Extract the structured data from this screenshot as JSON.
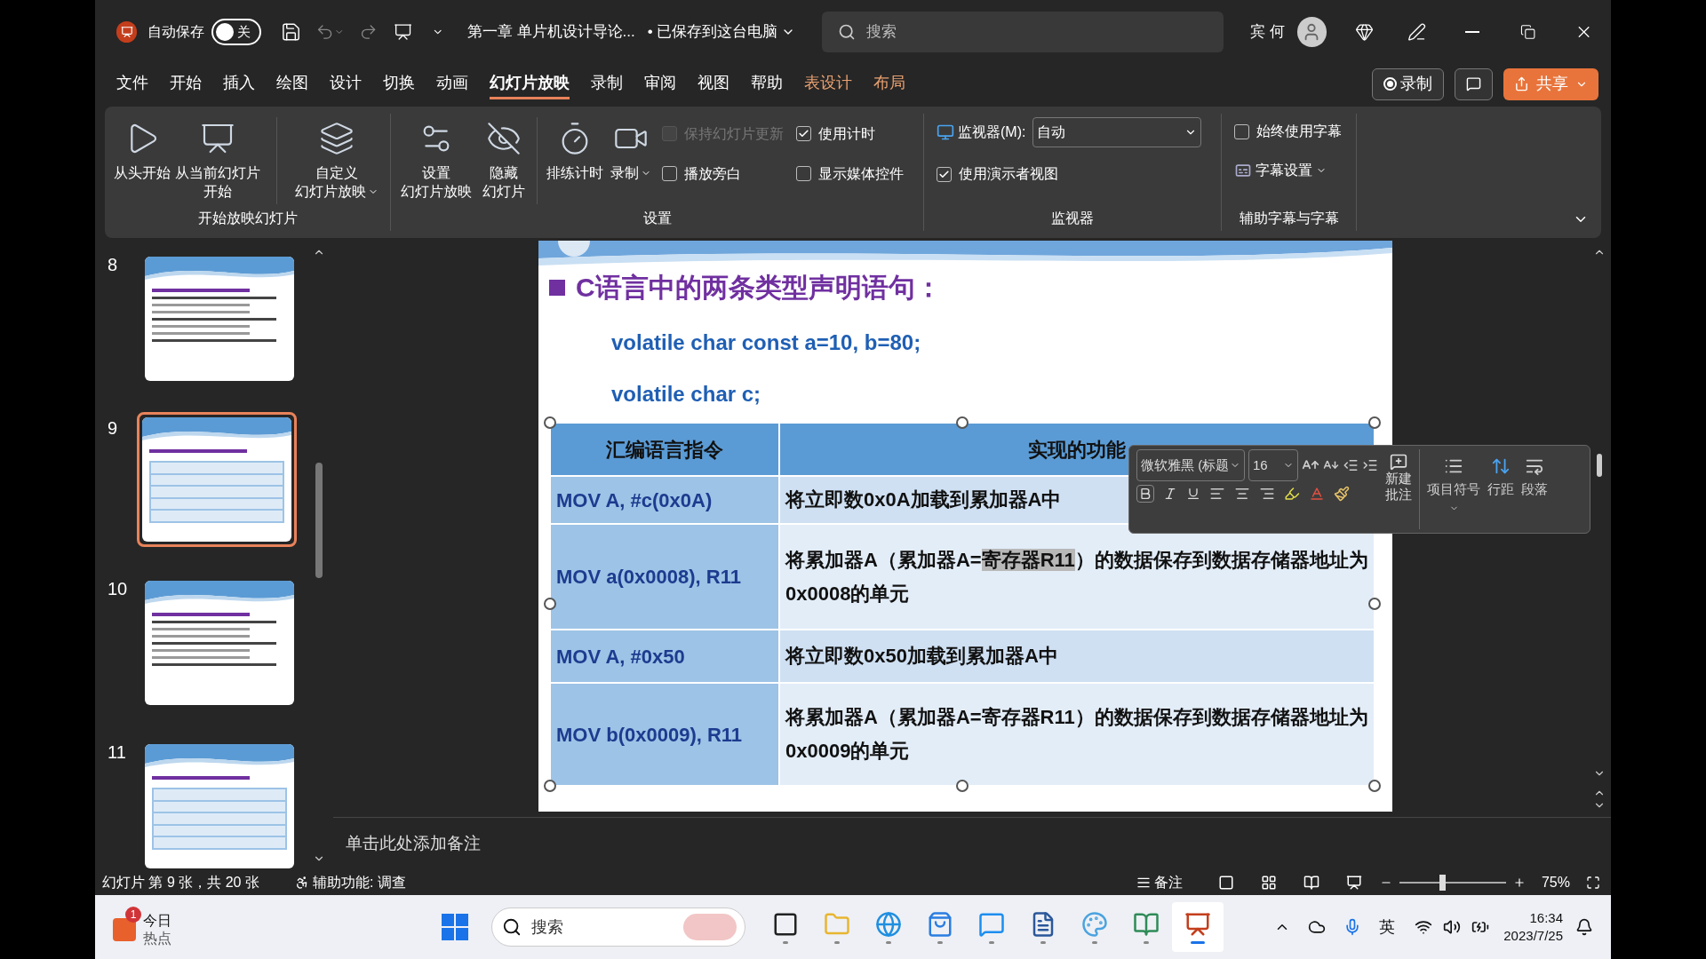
{
  "title_bar": {
    "autosave_label": "自动保存",
    "autosave_toggle": {
      "label": "关",
      "on": false
    },
    "document_title": "第一章 单片机设计导论...",
    "save_status": "• 已保存到这台电脑",
    "search": {
      "placeholder": "搜索"
    },
    "user_name": "宾 何"
  },
  "menu_tabs": [
    {
      "label": "文件",
      "selected": false,
      "kind": "normal"
    },
    {
      "label": "开始",
      "selected": false,
      "kind": "normal"
    },
    {
      "label": "插入",
      "selected": false,
      "kind": "normal"
    },
    {
      "label": "绘图",
      "selected": false,
      "kind": "normal"
    },
    {
      "label": "设计",
      "selected": false,
      "kind": "normal"
    },
    {
      "label": "切换",
      "selected": false,
      "kind": "normal"
    },
    {
      "label": "动画",
      "selected": false,
      "kind": "normal"
    },
    {
      "label": "幻灯片放映",
      "selected": true,
      "kind": "normal"
    },
    {
      "label": "录制",
      "selected": false,
      "kind": "normal"
    },
    {
      "label": "审阅",
      "selected": false,
      "kind": "normal"
    },
    {
      "label": "视图",
      "selected": false,
      "kind": "normal"
    },
    {
      "label": "帮助",
      "selected": false,
      "kind": "normal"
    },
    {
      "label": "表设计",
      "selected": false,
      "kind": "contextual"
    },
    {
      "label": "布局",
      "selected": false,
      "kind": "contextual"
    }
  ],
  "menu_actions": {
    "record": "录制",
    "share": "共享"
  },
  "ribbon": {
    "start_group": {
      "label": "开始放映幻灯片",
      "buttons": [
        {
          "lines": [
            "从头开始"
          ],
          "has_menu": false
        },
        {
          "lines": [
            "从当前幻灯片",
            "开始"
          ],
          "has_menu": false
        },
        {
          "lines": [
            "自定义",
            "幻灯片放映"
          ],
          "has_menu": true
        }
      ]
    },
    "settings_group": {
      "label": "设置",
      "buttons": [
        {
          "lines": [
            "设置",
            "幻灯片放映"
          ],
          "has_menu": false
        },
        {
          "lines": [
            "隐藏",
            "幻灯片"
          ],
          "has_menu": false
        },
        {
          "lines": [
            "排练计时"
          ],
          "has_menu": false
        },
        {
          "lines": [
            "录制"
          ],
          "has_menu": true
        }
      ],
      "checkboxes": [
        {
          "label": "保持幻灯片更新",
          "checked": false,
          "disabled": true
        },
        {
          "label": "使用计时",
          "checked": true,
          "disabled": false
        },
        {
          "label": "播放旁白",
          "checked": false,
          "disabled": false
        },
        {
          "label": "显示媒体控件",
          "checked": false,
          "disabled": false
        }
      ]
    },
    "monitor_group": {
      "label": "监视器",
      "monitor_label": "监视器(M):",
      "monitor_value": "自动",
      "presenter_view": {
        "label": "使用演示者视图",
        "checked": true
      }
    },
    "captions_group": {
      "label": "辅助字幕与字幕",
      "always_captions": {
        "label": "始终使用字幕",
        "checked": false
      },
      "caption_settings": "字幕设置"
    }
  },
  "thumbnails": [
    {
      "number": "8",
      "selected": false
    },
    {
      "number": "9",
      "selected": true
    },
    {
      "number": "10",
      "selected": false
    },
    {
      "number": "11",
      "selected": false
    }
  ],
  "slide": {
    "title": "C语言中的两条类型声明语句：",
    "code_lines": [
      "volatile char const a=10, b=80;",
      "volatile char c;"
    ],
    "table": {
      "columns": [
        "汇编语言指令",
        "实现的功能"
      ],
      "rows": [
        {
          "instruction": "MOV A, #c(0x0A)",
          "function": [
            {
              "text": "将立即数0x0A加载到累加器A中",
              "selected": false
            }
          ]
        },
        {
          "instruction": "MOV a(0x0008), R11",
          "function": [
            {
              "text": "将累加器A（累加器A=",
              "selected": false
            },
            {
              "text": "寄存器R11",
              "selected": true
            },
            {
              "text": "）的数据保存到数据存储器地址为0x0008的单元",
              "selected": false
            }
          ]
        },
        {
          "instruction": "MOV A, #0x50",
          "function": [
            {
              "text": "将立即数0x50加载到累加器A中",
              "selected": false
            }
          ]
        },
        {
          "instruction": "MOV b(0x0009), R11",
          "function": [
            {
              "text": "将累加器A（累加器A=寄存器R11）的数据保存到数据存储器地址为0x0009的单元",
              "selected": false
            }
          ]
        }
      ]
    }
  },
  "mini_toolbar": {
    "font": "微软雅黑 (标题",
    "size": "16",
    "new_comment": [
      "新建",
      "批注"
    ],
    "bullets": "项目符号",
    "line_spacing": "行距",
    "paragraph": "段落"
  },
  "notes": {
    "placeholder": "单击此处添加备注"
  },
  "status_bar": {
    "slide_info": "幻灯片 第 9 张，共 20 张",
    "accessibility": "辅助功能: 调查",
    "notes_button": "备注",
    "zoom_slider": {
      "level": 0.4
    },
    "zoom": "75%"
  },
  "taskbar": {
    "widget": {
      "badge": "1",
      "lines": [
        "今日",
        "热点"
      ]
    },
    "search": {
      "placeholder": "搜索"
    },
    "apps": [
      {
        "selected": false
      },
      {
        "selected": false
      },
      {
        "selected": false
      },
      {
        "selected": false
      },
      {
        "selected": false
      },
      {
        "selected": false
      },
      {
        "selected": false
      },
      {
        "selected": false
      },
      {
        "selected": true
      }
    ],
    "ime": "英",
    "time": "16:34",
    "date": "2023/7/25"
  }
}
